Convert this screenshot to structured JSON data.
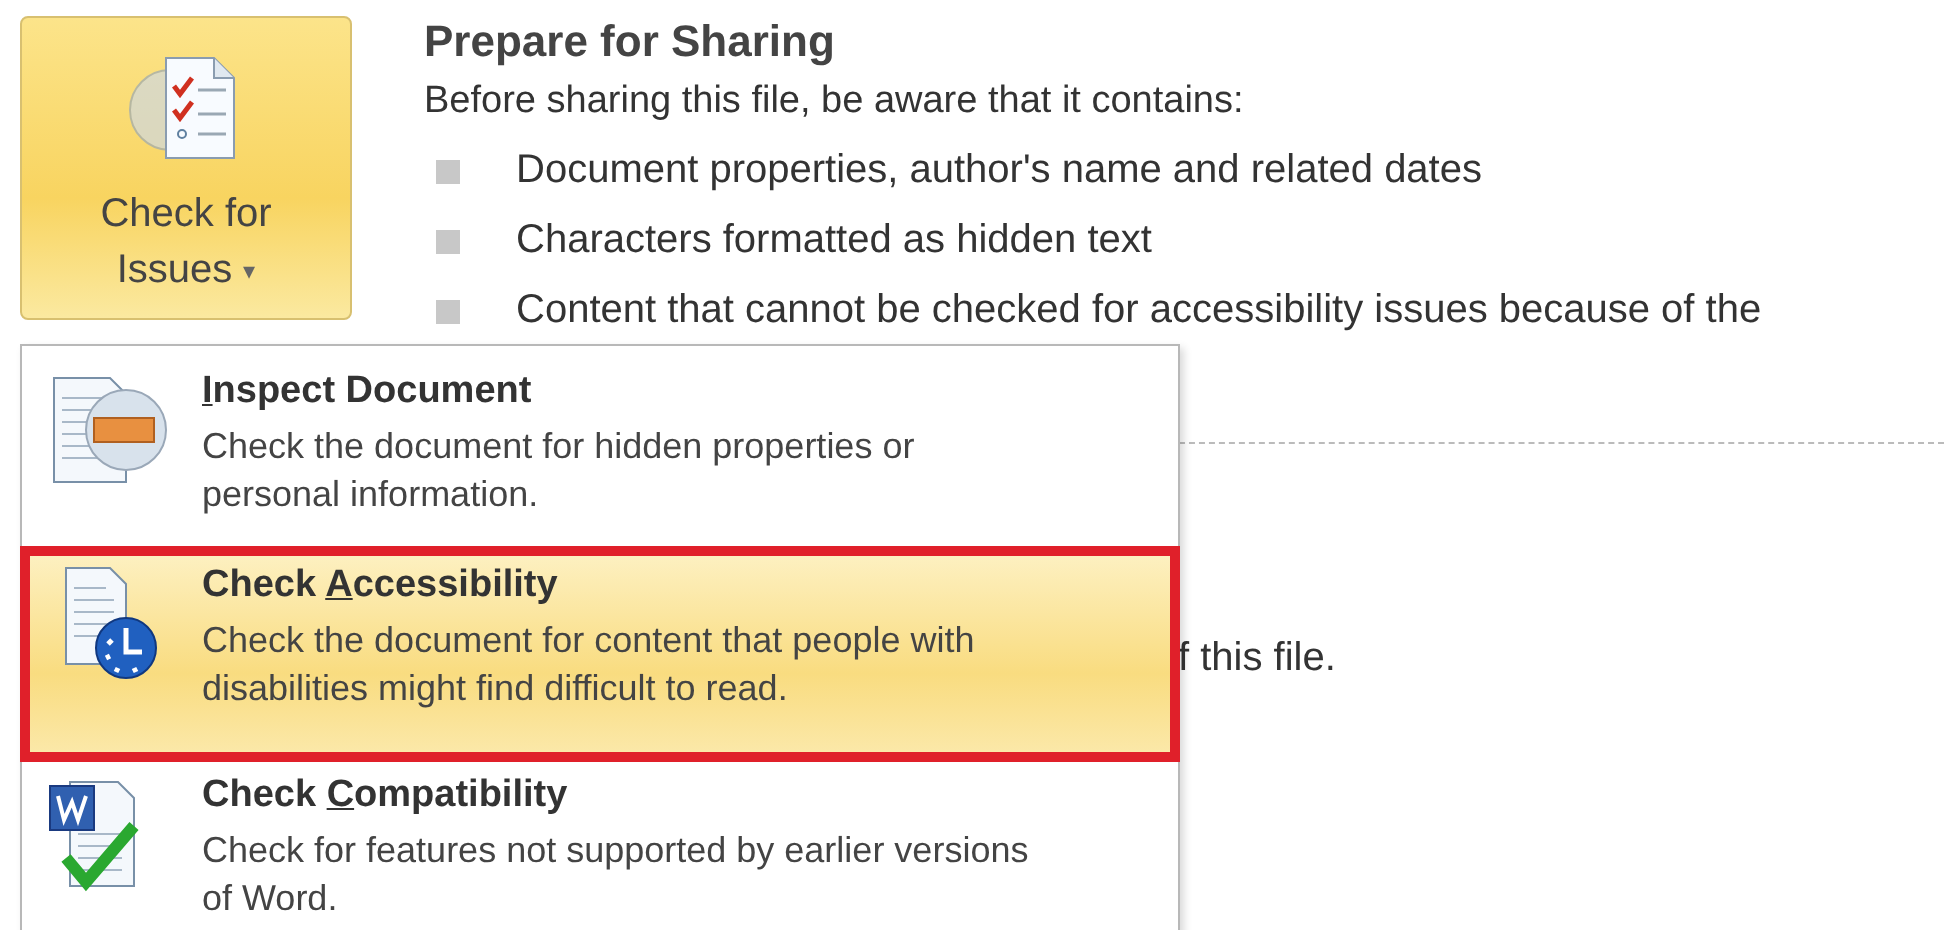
{
  "check_button": {
    "label_line1": "Check for",
    "label_line2": "Issues",
    "caret": "▾",
    "selected": true
  },
  "prepare": {
    "title": "Prepare for Sharing",
    "intro": "Before sharing this file, be aware that it contains:",
    "bullets": [
      "Document properties, author's name and related dates",
      "Characters formatted as hidden text",
      "Content that cannot be checked for accessibility issues because of the"
    ]
  },
  "covered_text": "f this file.",
  "menu": {
    "items": [
      {
        "kind": "inspect",
        "key": "I",
        "after": "nspect Document",
        "description": "Check the document for hidden properties or personal information.",
        "selected": false,
        "outlined": false
      },
      {
        "kind": "accessibility",
        "before": "Check ",
        "key": "A",
        "after": "ccessibility",
        "description": "Check the document for content that people with disabilities might find difficult to read.",
        "selected": true,
        "outlined": true
      },
      {
        "kind": "compatibility",
        "before": "Check ",
        "key": "C",
        "after": "ompatibility",
        "description": "Check for features not supported by earlier versions of Word.",
        "selected": false,
        "outlined": false
      }
    ]
  }
}
